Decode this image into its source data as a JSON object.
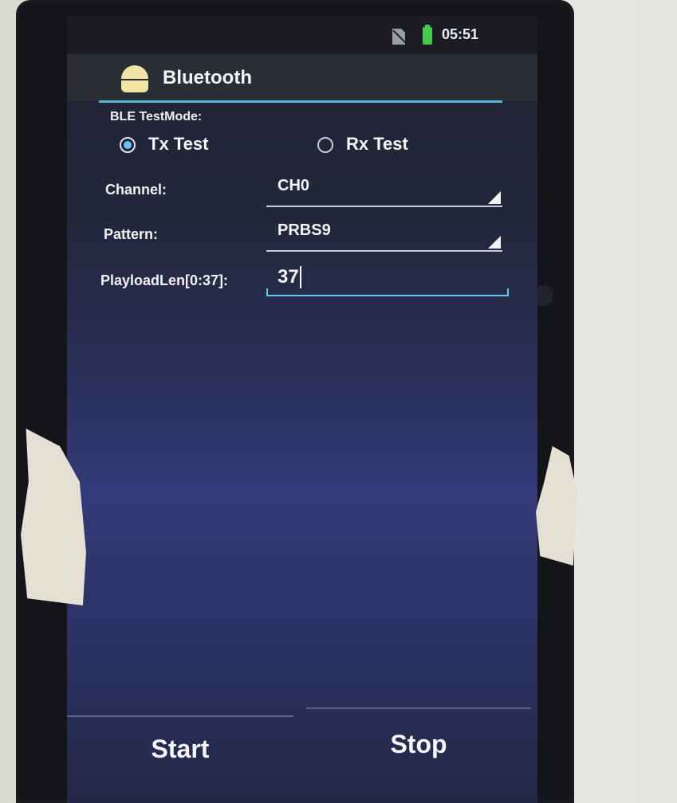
{
  "status_bar": {
    "time": "05:51",
    "icons": [
      "no-sim-icon",
      "battery-charging-icon"
    ]
  },
  "action_bar": {
    "app_icon": "android-robot-icon",
    "title": "Bluetooth"
  },
  "form": {
    "test_mode_label": "BLE TestMode:",
    "radios": [
      {
        "label": "Tx Test",
        "checked": true
      },
      {
        "label": "Rx Test",
        "checked": false
      }
    ],
    "channel": {
      "label": "Channel:",
      "value": "CH0"
    },
    "pattern": {
      "label": "Pattern:",
      "value": "PRBS9"
    },
    "payload": {
      "label": "PlayloadLen[0:37]:",
      "value": "37"
    }
  },
  "buttons": {
    "start": "Start",
    "stop": "Stop"
  },
  "colors": {
    "accent": "#5ec8ef",
    "action_bar": "#2a2d33",
    "status_bar": "#1b1d22"
  }
}
